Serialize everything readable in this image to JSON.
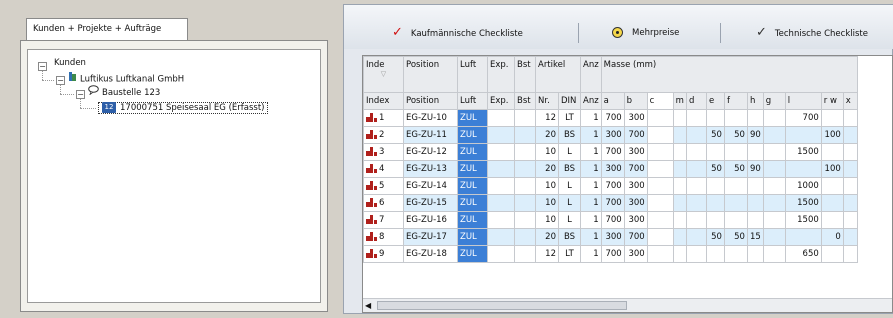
{
  "left": {
    "tab_label": "Kunden + Projekte + Aufträge",
    "tree": {
      "root": "Kunden",
      "company": "Luftikus Luftkanal GmbH",
      "site": "Baustelle 123",
      "order": "17000751 Speisesaal EG (Erfasst)",
      "expander_open": "−"
    }
  },
  "right": {
    "tabs": [
      {
        "label": "Kaufmännische Checkliste",
        "icon": "red-check-icon"
      },
      {
        "label": "Mehrpreise",
        "icon": "radio-selected-icon"
      },
      {
        "label": "Technische Checkliste",
        "icon": "check-icon"
      }
    ],
    "group_headers": {
      "inde": "Inde",
      "position": "Position",
      "luft": "Luft",
      "exp": "Exp.",
      "bst": "Bst",
      "artikel": "Artikel",
      "anz": "Anz",
      "masse": "Masse (mm)"
    },
    "columns": [
      "Index",
      "Position",
      "Luft",
      "Exp.",
      "Bst",
      "Nr.",
      "DIN",
      "Anz",
      "a",
      "b",
      "c",
      "m",
      "d",
      "e",
      "f",
      "h",
      "g",
      "l",
      "r w",
      "x"
    ],
    "rows": [
      {
        "idx": "1",
        "pos": "EG-ZU-10",
        "luft": "ZUL",
        "exp": "",
        "bst": "",
        "nr": "12",
        "din": "LT",
        "anz": "1",
        "a": "700",
        "b": "300",
        "c": "",
        "m": "",
        "d": "",
        "e": "",
        "f": "",
        "h": "",
        "g": "",
        "l": "700",
        "rw": "",
        "x": ""
      },
      {
        "idx": "2",
        "pos": "EG-ZU-11",
        "luft": "ZUL",
        "exp": "",
        "bst": "",
        "nr": "20",
        "din": "BS",
        "anz": "1",
        "a": "300",
        "b": "700",
        "c": "",
        "m": "",
        "d": "",
        "e": "50",
        "f": "50",
        "h": "90",
        "g": "",
        "l": "",
        "rw": "100",
        "x": ""
      },
      {
        "idx": "3",
        "pos": "EG-ZU-12",
        "luft": "ZUL",
        "exp": "",
        "bst": "",
        "nr": "10",
        "din": "L",
        "anz": "1",
        "a": "700",
        "b": "300",
        "c": "",
        "m": "",
        "d": "",
        "e": "",
        "f": "",
        "h": "",
        "g": "",
        "l": "1500",
        "rw": "",
        "x": ""
      },
      {
        "idx": "4",
        "pos": "EG-ZU-13",
        "luft": "ZUL",
        "exp": "",
        "bst": "",
        "nr": "20",
        "din": "BS",
        "anz": "1",
        "a": "300",
        "b": "700",
        "c": "",
        "m": "",
        "d": "",
        "e": "50",
        "f": "50",
        "h": "90",
        "g": "",
        "l": "",
        "rw": "100",
        "x": ""
      },
      {
        "idx": "5",
        "pos": "EG-ZU-14",
        "luft": "ZUL",
        "exp": "",
        "bst": "",
        "nr": "10",
        "din": "L",
        "anz": "1",
        "a": "700",
        "b": "300",
        "c": "",
        "m": "",
        "d": "",
        "e": "",
        "f": "",
        "h": "",
        "g": "",
        "l": "1000",
        "rw": "",
        "x": ""
      },
      {
        "idx": "6",
        "pos": "EG-ZU-15",
        "luft": "ZUL",
        "exp": "",
        "bst": "",
        "nr": "10",
        "din": "L",
        "anz": "1",
        "a": "700",
        "b": "300",
        "c": "",
        "m": "",
        "d": "",
        "e": "",
        "f": "",
        "h": "",
        "g": "",
        "l": "1500",
        "rw": "",
        "x": ""
      },
      {
        "idx": "7",
        "pos": "EG-ZU-16",
        "luft": "ZUL",
        "exp": "",
        "bst": "",
        "nr": "10",
        "din": "L",
        "anz": "1",
        "a": "700",
        "b": "300",
        "c": "",
        "m": "",
        "d": "",
        "e": "",
        "f": "",
        "h": "",
        "g": "",
        "l": "1500",
        "rw": "",
        "x": ""
      },
      {
        "idx": "8",
        "pos": "EG-ZU-17",
        "luft": "ZUL",
        "exp": "",
        "bst": "",
        "nr": "20",
        "din": "BS",
        "anz": "1",
        "a": "300",
        "b": "700",
        "c": "",
        "m": "",
        "d": "",
        "e": "50",
        "f": "50",
        "h": "15",
        "g": "",
        "l": "",
        "rw": "0",
        "x": ""
      },
      {
        "idx": "9",
        "pos": "EG-ZU-18",
        "luft": "ZUL",
        "exp": "",
        "bst": "",
        "nr": "12",
        "din": "LT",
        "anz": "1",
        "a": "700",
        "b": "300",
        "c": "",
        "m": "",
        "d": "",
        "e": "",
        "f": "",
        "h": "",
        "g": "",
        "l": "650",
        "rw": "",
        "x": ""
      }
    ],
    "colors": {
      "luft_cell": "#3c7fd6",
      "alt_row": "#dceefb",
      "row_icon": "#b0201c"
    }
  }
}
